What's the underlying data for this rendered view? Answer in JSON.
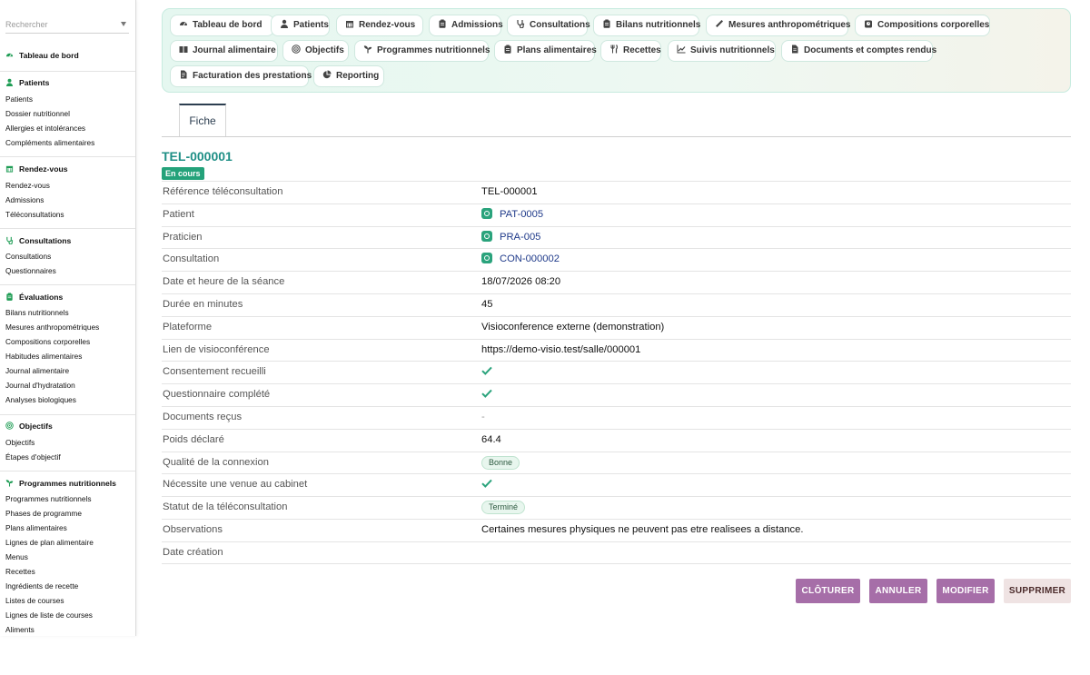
{
  "sidebar": {
    "search_placeholder": "Rechercher",
    "sections": [
      {
        "title": "Tableau de bord",
        "icon": "dashboard-icon",
        "items": []
      },
      {
        "title": "Patients",
        "icon": "user-icon",
        "items": [
          "Patients",
          "Dossier nutritionnel",
          "Allergies et intolérances",
          "Compléments alimentaires"
        ]
      },
      {
        "title": "Rendez-vous",
        "icon": "calendar-icon",
        "items": [
          "Rendez-vous",
          "Admissions",
          "Téléconsultations"
        ]
      },
      {
        "title": "Consultations",
        "icon": "stethoscope-icon",
        "items": [
          "Consultations",
          "Questionnaires"
        ]
      },
      {
        "title": "Évaluations",
        "icon": "clipboard-icon",
        "items": [
          "Bilans nutritionnels",
          "Mesures anthropométriques",
          "Compositions corporelles",
          "Habitudes alimentaires",
          "Journal alimentaire",
          "Journal d'hydratation",
          "Analyses biologiques"
        ]
      },
      {
        "title": "Objectifs",
        "icon": "target-icon",
        "items": [
          "Objectifs",
          "Étapes d'objectif"
        ]
      },
      {
        "title": "Programmes nutritionnels",
        "icon": "sprout-icon",
        "items": [
          "Programmes nutritionnels",
          "Phases de programme",
          "Plans alimentaires",
          "Lignes de plan alimentaire",
          "Menus",
          "Recettes",
          "Ingrédients de recette",
          "Listes de courses",
          "Lignes de liste de courses",
          "Aliments"
        ]
      }
    ]
  },
  "nav": {
    "pills": [
      {
        "label": "Tableau de bord",
        "icon": "dashboard-icon"
      },
      {
        "label": "Patients",
        "icon": "user-icon"
      },
      {
        "label": "Rendez-vous",
        "icon": "calendar-icon"
      },
      {
        "label": "Admissions",
        "icon": "clipboard-icon"
      },
      {
        "label": "Consultations",
        "icon": "stethoscope-icon"
      },
      {
        "label": "Bilans nutritionnels",
        "icon": "clipboard-icon"
      },
      {
        "label": "Mesures anthropométriques",
        "icon": "ruler-icon"
      },
      {
        "label": "Compositions corporelles",
        "icon": "scale-icon"
      },
      {
        "label": "Journal alimentaire",
        "icon": "book-icon"
      },
      {
        "label": "Objectifs",
        "icon": "target-icon"
      },
      {
        "label": "Programmes nutritionnels",
        "icon": "sprout-icon"
      },
      {
        "label": "Plans alimentaires",
        "icon": "clipboard-icon"
      },
      {
        "label": "Recettes",
        "icon": "utensils-icon"
      },
      {
        "label": "Suivis nutritionnels",
        "icon": "chart-line-icon"
      },
      {
        "label": "Documents et comptes rendus",
        "icon": "document-icon"
      },
      {
        "label": "Facturation des prestations",
        "icon": "invoice-icon"
      },
      {
        "label": "Reporting",
        "icon": "pie-chart-icon"
      }
    ]
  },
  "tabs": [
    {
      "label": "Fiche"
    }
  ],
  "record": {
    "title": "TEL-000001",
    "state": "En cours",
    "fields": [
      {
        "label": "Référence téléconsultation",
        "value": "TEL-000001",
        "kind": "text"
      },
      {
        "label": "Patient",
        "value": "PAT-0005",
        "kind": "link"
      },
      {
        "label": "Praticien",
        "value": "PRA-005",
        "kind": "link"
      },
      {
        "label": "Consultation",
        "value": "CON-000002",
        "kind": "link"
      },
      {
        "label": "Date et heure de la séance",
        "value": "18/07/2026 08:20",
        "kind": "text"
      },
      {
        "label": "Durée en minutes",
        "value": "45",
        "kind": "text"
      },
      {
        "label": "Plateforme",
        "value": "Visioconference externe (demonstration)",
        "kind": "text"
      },
      {
        "label": "Lien de visioconférence",
        "value": "https://demo-visio.test/salle/000001",
        "kind": "text"
      },
      {
        "label": "Consentement recueilli",
        "value": true,
        "kind": "check"
      },
      {
        "label": "Questionnaire complété",
        "value": true,
        "kind": "check"
      },
      {
        "label": "Documents reçus",
        "value": "-",
        "kind": "dash"
      },
      {
        "label": "Poids déclaré",
        "value": "64.4",
        "kind": "text"
      },
      {
        "label": "Qualité de la connexion",
        "value": "Bonne",
        "kind": "badge"
      },
      {
        "label": "Nécessite une venue au cabinet",
        "value": true,
        "kind": "check"
      },
      {
        "label": "Statut de la téléconsultation",
        "value": "Terminé",
        "kind": "badge"
      },
      {
        "label": "Observations",
        "value": "Certaines mesures physiques ne peuvent pas etre realisees a distance.",
        "kind": "text"
      },
      {
        "label": "Date création",
        "value": "",
        "kind": "text"
      }
    ]
  },
  "actions": {
    "close": "CLÔTURER",
    "cancel": "ANNULER",
    "edit": "MODIFIER",
    "delete": "SUPPRIMER"
  },
  "colors": {
    "accent_green": "#24a27a",
    "title_teal": "#1f8f86",
    "action_purple": "#a66ea8",
    "link_blue": "#1f3a8a"
  }
}
